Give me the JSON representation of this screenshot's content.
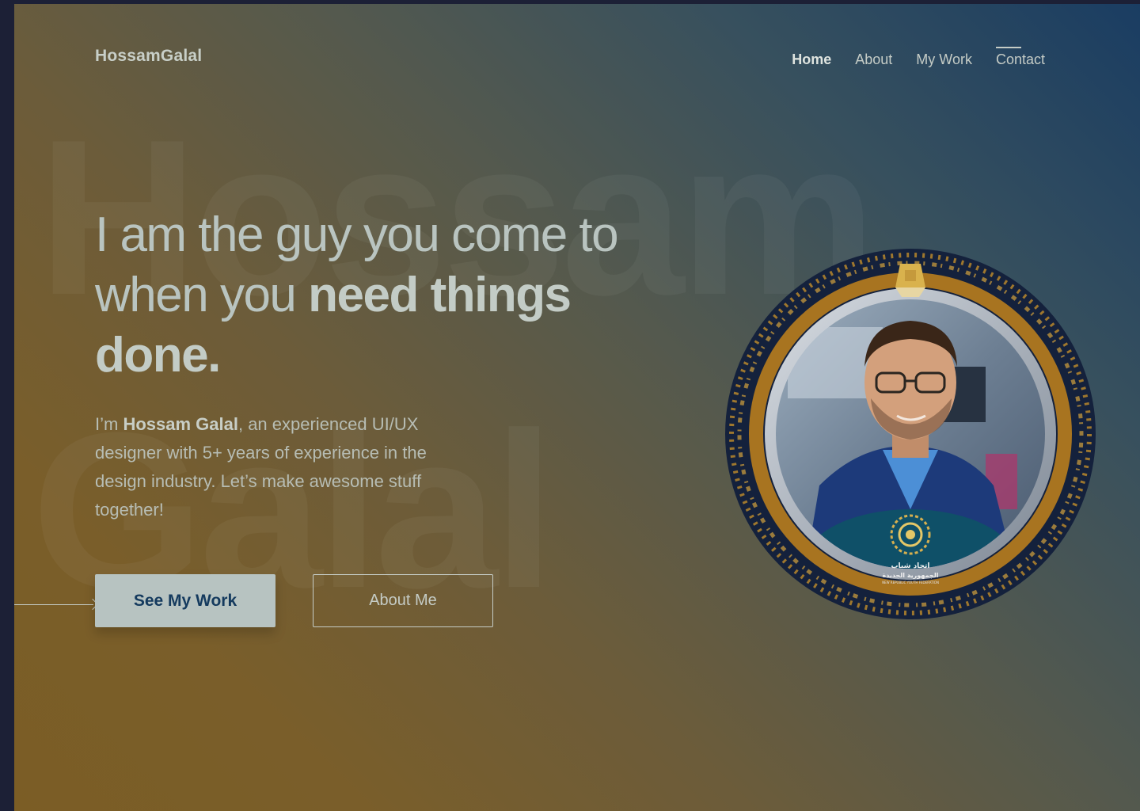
{
  "header": {
    "logo": "HossamGalal",
    "nav": [
      {
        "label": "Home"
      },
      {
        "label": "About"
      },
      {
        "label": "My Work"
      },
      {
        "label": "Contact"
      }
    ]
  },
  "background": {
    "word1": "Hossam",
    "word2": "Galal"
  },
  "hero": {
    "headline_part1": "I am the guy you come to when you ",
    "headline_bold": "need things done.",
    "intro_prefix": "I’m ",
    "intro_name": "Hossam Galal",
    "intro_suffix": ", an experienced UI/UX designer with 5+ years of experience in the design industry. Let’s make awesome stuff together!",
    "primary_button": "See My Work",
    "secondary_button": "About Me"
  },
  "badge": {
    "arabic_line1": "اتحاد شباب",
    "arabic_line2": "الجمهورية الجديدة",
    "english_line": "NEW REPUBLIC YOUTH FEDERATION"
  },
  "colors": {
    "accent_navy": "#143a5e",
    "button_bg": "#b7c3c1",
    "gold_ring": "#b07a22",
    "text_light": "#c5ccc6"
  }
}
